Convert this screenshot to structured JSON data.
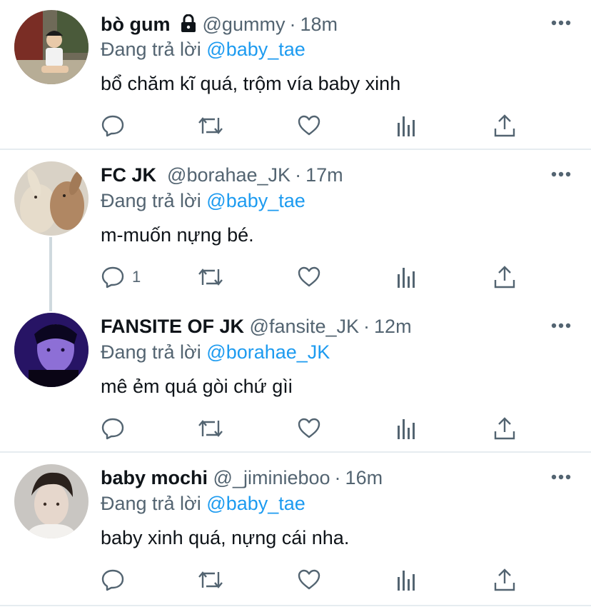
{
  "tweets": [
    {
      "name": "bò gum",
      "handle": "@gummy",
      "dot": "·",
      "time": "18m",
      "reply_prefix": "Đang trả lời",
      "reply_to": "@baby_tae",
      "text": "bổ chăm kĩ quá, trộm vía baby xinh",
      "reply_count": "",
      "locked": true
    },
    {
      "name": "FC JK",
      "handle": "@borahae_JK",
      "dot": "·",
      "time": "17m",
      "reply_prefix": "Đang trả lời",
      "reply_to": "@baby_tae",
      "text": "m-muốn nựng bé.",
      "reply_count": "1",
      "locked": false
    },
    {
      "name": "FANSITE OF JK",
      "handle": "@fansite_JK",
      "dot": "·",
      "time": "12m",
      "reply_prefix": "Đang trả lời",
      "reply_to": "@borahae_JK",
      "text": "mê ẻm quá gòi chứ gìi",
      "reply_count": "",
      "locked": false
    },
    {
      "name": "baby mochi",
      "handle": "@_jiminieboo",
      "dot": "·",
      "time": "16m",
      "reply_prefix": "Đang trả lời",
      "reply_to": "@baby_tae",
      "text": "baby xinh quá, nựng cái nha.",
      "reply_count": "",
      "locked": false
    }
  ],
  "icons": {
    "reply": "reply-icon",
    "retweet": "retweet-icon",
    "like": "heart-icon",
    "analytics": "analytics-icon",
    "share": "share-icon",
    "more": "more-icon",
    "lock": "lock-icon"
  },
  "colors": {
    "link": "#1d9bf0",
    "secondary_text": "#536471",
    "divider": "#e6ecf0"
  }
}
